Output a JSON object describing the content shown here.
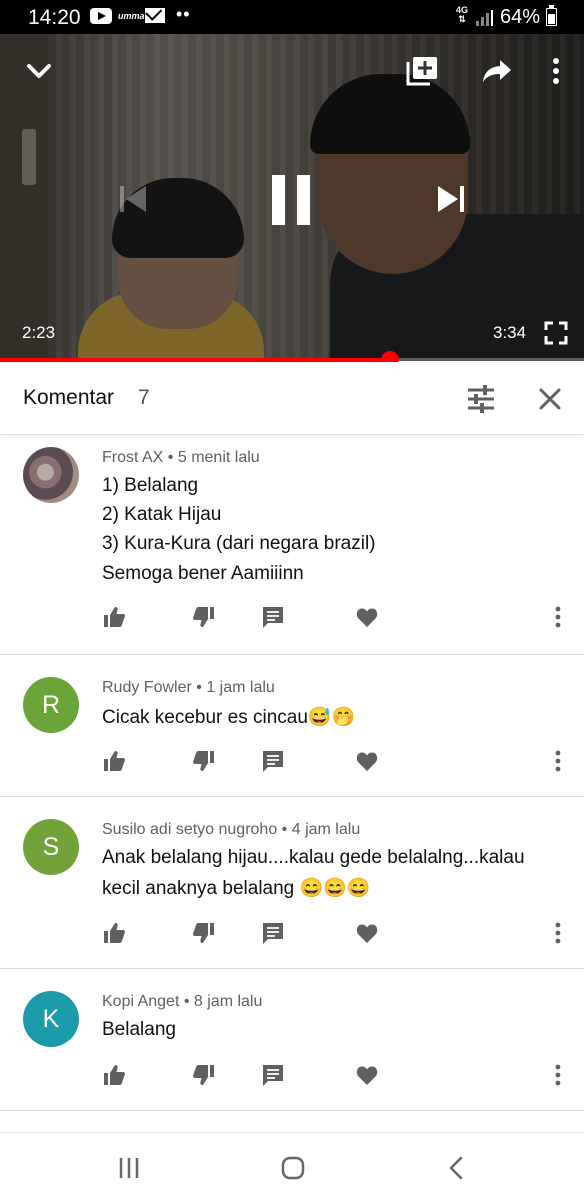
{
  "status_bar": {
    "time": "14:20",
    "notification_label": "umma",
    "network": "4G",
    "battery": "64%"
  },
  "player": {
    "current_time": "2:23",
    "total_time": "3:34",
    "progress": 0.667,
    "icons": [
      "chevron-down-icon",
      "add-to-playlist-icon",
      "share-icon",
      "more-vert-icon",
      "skip-previous-icon",
      "pause-icon",
      "skip-next-icon",
      "fullscreen-icon"
    ]
  },
  "comments": {
    "title": "Komentar",
    "count": "7",
    "items": [
      {
        "author": "Frost AX",
        "time": "5 menit lalu",
        "avatar_letter": "",
        "avatar_color": "",
        "lines": [
          "1) Belalang",
          "2) Katak Hijau",
          "3) Kura-Kura (dari negara brazil)",
          "Semoga bener Aamiiinn"
        ]
      },
      {
        "author": "Rudy Fowler",
        "time": "1 jam lalu",
        "avatar_letter": "R",
        "avatar_color": "#6aa53a",
        "lines": [
          "Cicak kecebur es cincau😅🤭"
        ]
      },
      {
        "author": "Susilo adi setyo nugroho",
        "time": "4 jam lalu",
        "avatar_letter": "S",
        "avatar_color": "#72a33b",
        "lines": [
          "Anak belalang hijau....kalau gede belalalng...kalau",
          "kecil anaknya belalang 😄😄😄"
        ]
      },
      {
        "author": "Kopi Anget",
        "time": "8 jam lalu",
        "avatar_letter": "K",
        "avatar_color": "#1b9aaa",
        "lines": [
          "Belalang"
        ]
      }
    ]
  },
  "colors": {
    "accent": "#ff0000",
    "icon_grey": "#606060"
  }
}
